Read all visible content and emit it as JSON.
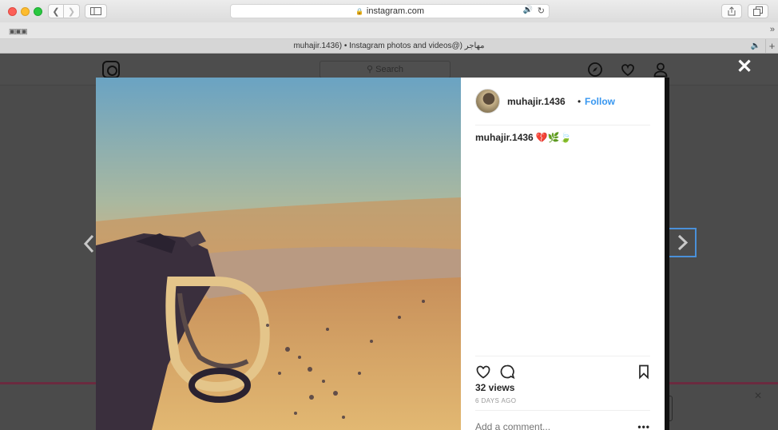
{
  "browser": {
    "url": "instagram.com",
    "tab_title": "muhajir.1436) • Instagram photos and videos@) مهاجر",
    "back_icon": "chevron-left-icon",
    "forward_icon": "chevron-right-icon"
  },
  "instagram": {
    "search_placeholder": "Search",
    "icons": [
      "instagram-logo-icon",
      "compass-icon",
      "heart-icon",
      "user-icon"
    ]
  },
  "post": {
    "username": "muhajir.1436",
    "separator": "•",
    "follow_label": "Follow",
    "caption_user": "muhajir.1436",
    "caption_emoji": "💔🌿🍃",
    "views": "32 views",
    "timestamp": "6 DAYS AGO",
    "comment_placeholder": "Add a comment...",
    "more": "•••"
  },
  "colors": {
    "follow_blue": "#3897f0",
    "focus_ring": "#4a90d9"
  }
}
